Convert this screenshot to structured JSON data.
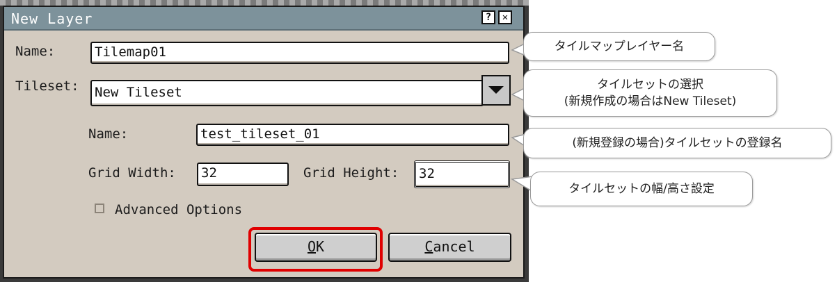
{
  "dialog": {
    "title": "New Layer",
    "help_button": "?",
    "close_button": "✕"
  },
  "form": {
    "name_label": "Name:",
    "name_value": "Tilemap01",
    "tileset_label": "Tileset:",
    "tileset_value": "New Tileset",
    "tileset_name_label": "Name:",
    "tileset_name_value": "test_tileset_01",
    "grid_width_label": "Grid Width:",
    "grid_width_value": "32",
    "grid_height_label": "Grid Height:",
    "grid_height_value": "32",
    "advanced_options_label": "Advanced Options",
    "advanced_options_checked": false
  },
  "buttons": {
    "ok_first": "O",
    "ok_rest": "K",
    "cancel_first": "C",
    "cancel_rest": "ancel"
  },
  "callouts": {
    "layer_name": "タイルマップレイヤー名",
    "tileset_select_line1": "タイルセットの選択",
    "tileset_select_line2": "(新規作成の場合はNew Tileset)",
    "tileset_name": "(新規登録の場合)タイルセットの登録名",
    "grid_size": "タイルセットの幅/高さ設定"
  },
  "colors": {
    "titlebar": "#7d929b",
    "dialog_bg": "#d3cbc0",
    "highlight_ring": "#e00000"
  }
}
